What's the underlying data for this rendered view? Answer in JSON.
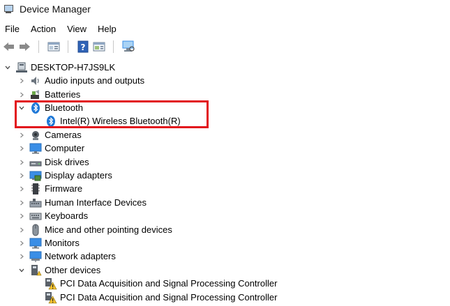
{
  "window": {
    "title": "Device Manager",
    "icon": "device-manager-icon"
  },
  "menu": [
    {
      "key": "file",
      "label": "File"
    },
    {
      "key": "action",
      "label": "Action"
    },
    {
      "key": "view",
      "label": "View"
    },
    {
      "key": "help",
      "label": "Help"
    }
  ],
  "toolbar": {
    "back_icon": "back-arrow-icon",
    "forward_icon": "forward-arrow-icon",
    "properties_icon": "properties-icon",
    "help_icon": "help-icon",
    "update_driver_icon": "update-driver-icon",
    "scan_icon": "scan-hardware-icon"
  },
  "tree": {
    "root": {
      "label": "DESKTOP-H7JS9LK",
      "expanded": true
    },
    "categories": [
      {
        "label": "Audio inputs and outputs",
        "icon": "speaker-icon",
        "expanded": false
      },
      {
        "label": "Batteries",
        "icon": "battery-icon",
        "expanded": false
      },
      {
        "label": "Bluetooth",
        "icon": "bluetooth-icon",
        "expanded": true,
        "children": [
          {
            "label": "Intel(R) Wireless Bluetooth(R)",
            "icon": "bluetooth-icon"
          }
        ]
      },
      {
        "label": "Cameras",
        "icon": "camera-icon",
        "expanded": false
      },
      {
        "label": "Computer",
        "icon": "monitor-icon",
        "expanded": false
      },
      {
        "label": "Disk drives",
        "icon": "disk-drive-icon",
        "expanded": false
      },
      {
        "label": "Display adapters",
        "icon": "display-adapter-icon",
        "expanded": false
      },
      {
        "label": "Firmware",
        "icon": "firmware-chip-icon",
        "expanded": false
      },
      {
        "label": "Human Interface Devices",
        "icon": "hid-icon",
        "expanded": false
      },
      {
        "label": "Keyboards",
        "icon": "keyboard-icon",
        "expanded": false
      },
      {
        "label": "Mice and other pointing devices",
        "icon": "mouse-icon",
        "expanded": false
      },
      {
        "label": "Monitors",
        "icon": "monitor-icon",
        "expanded": false
      },
      {
        "label": "Network adapters",
        "icon": "network-adapter-icon",
        "expanded": false
      },
      {
        "label": "Other devices",
        "icon": "other-devices-icon",
        "expanded": true,
        "children": [
          {
            "label": "PCI Data Acquisition and Signal Processing Controller",
            "icon": "warning-device-icon"
          },
          {
            "label": "PCI Data Acquisition and Signal Processing Controller",
            "icon": "warning-device-icon"
          }
        ]
      }
    ]
  },
  "colors": {
    "highlight": "#e2141c",
    "bluetooth": "#1e78d7",
    "monitor": "#3a8ee6"
  }
}
